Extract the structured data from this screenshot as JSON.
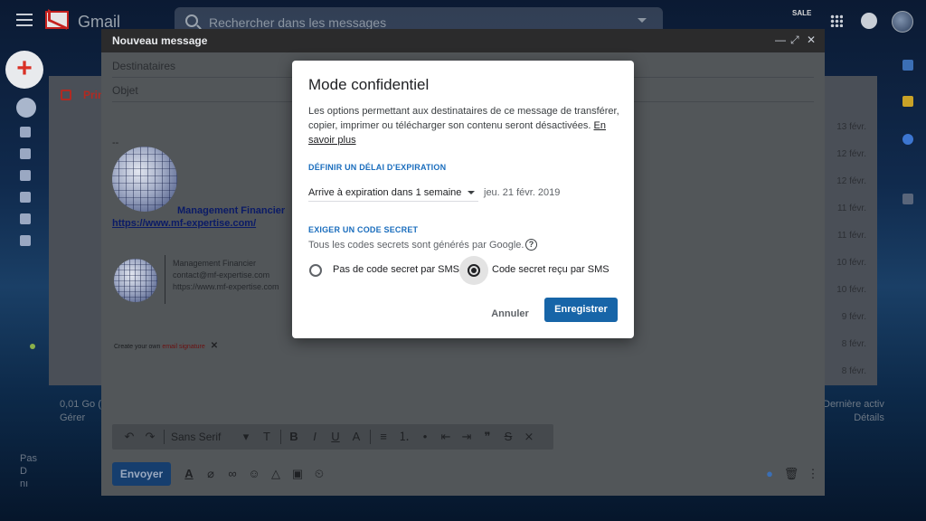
{
  "gmail": {
    "app_name": "Gmail",
    "search_placeholder": "Rechercher dans les messages",
    "badge": "SALE",
    "primary_tab": "Prin",
    "dates": [
      "13 févr.",
      "12 févr.",
      "12 févr.",
      "11 févr.",
      "11 févr.",
      "10 févr.",
      "10 févr.",
      "9 févr.",
      "8 févr.",
      "8 févr."
    ],
    "storage_line1": "0,01 Go (0",
    "storage_line2": "Gérer",
    "footer_right_line1": "Dernière activ",
    "footer_right_line2": "Détails",
    "left_text_line1": "Pas",
    "left_text_line2": "D",
    "left_text_line3": "nı"
  },
  "compose": {
    "title": "Nouveau message",
    "recipients_label": "Destinataires",
    "subject_label": "Objet",
    "signature_dashes": "--",
    "signature_company": "Management Financier",
    "signature_url": "https://www.mf-expertise.com/",
    "card_line1": "Management Financier",
    "card_line2": "contact@mf-expertise.com",
    "card_line3": "https://www.mf-expertise.com",
    "create_sig_prefix": "Create your own",
    "create_sig_link": "email signature",
    "toolbar_font": "Sans Serif",
    "send_label": "Envoyer"
  },
  "dialog": {
    "title": "Mode confidentiel",
    "description": "Les options permettant aux destinataires de ce message de transférer, copier, imprimer ou télécharger son contenu seront désactivées.",
    "learn_more": "En savoir plus",
    "expiration_section": "DÉFINIR UN DÉLAI D'EXPIRATION",
    "expiration_value": "Arrive à expiration dans 1 semaine",
    "expiration_date": "jeu. 21 févr. 2019",
    "code_section": "EXIGER UN CODE SECRET",
    "code_info": "Tous les codes secrets sont générés par Google.",
    "option_no_sms": "Pas de code secret par SMS",
    "option_sms": "Code secret reçu par SMS",
    "selected_option": "option_sms",
    "cancel_label": "Annuler",
    "save_label": "Enregistrer"
  },
  "colors": {
    "accent": "#1765a8",
    "section_label": "#1a6dbd",
    "compose_header": "#2b2b2c"
  }
}
